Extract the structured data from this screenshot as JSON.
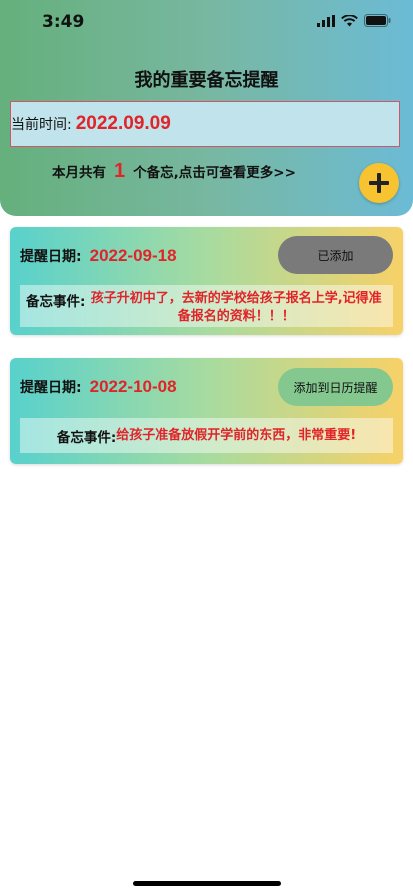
{
  "status_bar": {
    "time": "3:49"
  },
  "header": {
    "title": "我的重要备忘提醒",
    "current_time_label": "当前时间:",
    "current_time_value": "2022.09.09",
    "summary_prefix": "本月共有",
    "summary_count": "1",
    "summary_suffix": "个备忘,点击可查看更多>>"
  },
  "reminders": [
    {
      "date_label": "提醒日期:",
      "date_value": "2022-09-18",
      "button_label": "已添加",
      "event_label": "备忘事件:",
      "event_text": "孩子升初中了，去新的学校给孩子报名上学,记得准备报名的资料！！！"
    },
    {
      "date_label": "提醒日期:",
      "date_value": "2022-10-08",
      "button_label": "添加到日历提醒",
      "event_label": "备忘事件:",
      "event_text": "给孩子准备放假开学前的东西，非常重要!"
    }
  ],
  "colors": {
    "accent_red": "#e0242a",
    "fab_yellow": "#f7c331"
  },
  "icons": [
    "signal-icon",
    "wifi-icon",
    "battery-icon",
    "plus-icon"
  ]
}
